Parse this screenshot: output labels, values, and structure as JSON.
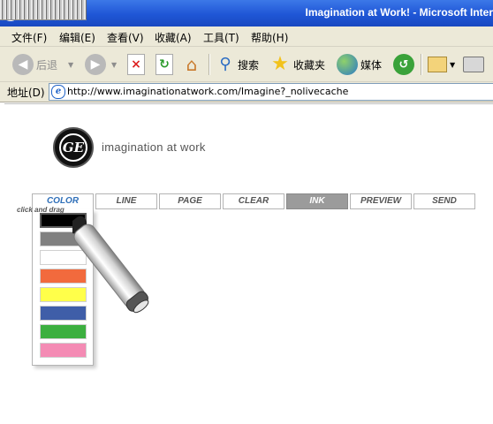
{
  "window": {
    "title": "Imagination at Work! - Microsoft Inter"
  },
  "menu": [
    {
      "label": "文件(F)"
    },
    {
      "label": "编辑(E)"
    },
    {
      "label": "查看(V)"
    },
    {
      "label": "收藏(A)"
    },
    {
      "label": "工具(T)"
    },
    {
      "label": "帮助(H)"
    }
  ],
  "toolbar": {
    "back_label": "后退",
    "search_label": "搜索",
    "favorites_label": "收藏夹",
    "media_label": "媒体"
  },
  "address": {
    "label": "地址(D)",
    "url": "http://www.imaginationatwork.com/Imagine?_nolivecache"
  },
  "page": {
    "logo_text": "GE",
    "tagline": "imagination at work",
    "nav": [
      {
        "label": "COLOR"
      },
      {
        "label": "LINE"
      },
      {
        "label": "PAGE"
      },
      {
        "label": "CLEAR"
      },
      {
        "label": "INK"
      },
      {
        "label": "PREVIEW"
      },
      {
        "label": "SEND"
      }
    ],
    "hint": "click and drag",
    "palette": [
      {
        "color": "#000000",
        "selected": true
      },
      {
        "color": "#808080"
      },
      {
        "color": "#ffffff"
      },
      {
        "color": "#f26a3d"
      },
      {
        "color": "#ffff4a"
      },
      {
        "color": "#3f5ea8"
      },
      {
        "color": "#3caf3f"
      },
      {
        "color": "#f48bb4"
      }
    ]
  }
}
